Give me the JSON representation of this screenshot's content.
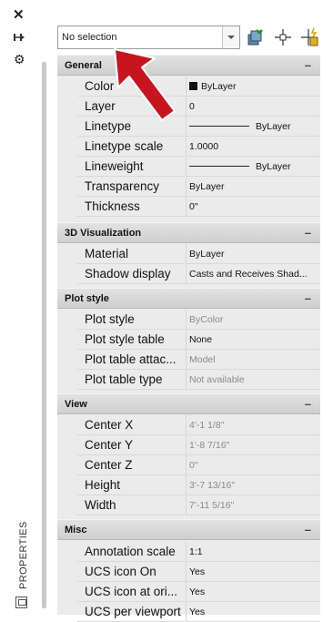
{
  "palette": {
    "selected": "No selection"
  },
  "sections": {
    "general": {
      "title": "General",
      "rows": [
        {
          "name": "Color",
          "value": "ByLayer"
        },
        {
          "name": "Layer",
          "value": "0"
        },
        {
          "name": "Linetype",
          "value": "ByLayer"
        },
        {
          "name": "Linetype scale",
          "value": "1.0000"
        },
        {
          "name": "Lineweight",
          "value": "ByLayer"
        },
        {
          "name": "Transparency",
          "value": "ByLayer"
        },
        {
          "name": "Thickness",
          "value": "0\""
        }
      ]
    },
    "viz3d": {
      "title": "3D Visualization",
      "rows": [
        {
          "name": "Material",
          "value": "ByLayer"
        },
        {
          "name": "Shadow display",
          "value": "Casts and Receives Shad..."
        }
      ]
    },
    "plot": {
      "title": "Plot style",
      "rows": [
        {
          "name": "Plot style",
          "value": "ByColor"
        },
        {
          "name": "Plot style table",
          "value": "None"
        },
        {
          "name": "Plot table attac...",
          "value": "Model"
        },
        {
          "name": "Plot table type",
          "value": "Not available"
        }
      ]
    },
    "view": {
      "title": "View",
      "rows": [
        {
          "name": "Center X",
          "value": "4'-1 1/8\""
        },
        {
          "name": "Center Y",
          "value": "1'-8 7/16\""
        },
        {
          "name": "Center Z",
          "value": "0\""
        },
        {
          "name": "Height",
          "value": "3'-7 13/16\""
        },
        {
          "name": "Width",
          "value": "7'-11 5/16\""
        }
      ]
    },
    "misc": {
      "title": "Misc",
      "rows": [
        {
          "name": "Annotation scale",
          "value": "1:1"
        },
        {
          "name": "UCS icon On",
          "value": "Yes"
        },
        {
          "name": "UCS icon at ori...",
          "value": "Yes"
        },
        {
          "name": "UCS per viewport",
          "value": "Yes"
        }
      ]
    }
  },
  "sidebar": {
    "title": "PROPERTIES"
  },
  "icons": {
    "close": "close-icon",
    "pin": "pin-icon",
    "settings": "gear-icon",
    "dropdown": "chevron-down-icon",
    "quick_select": "quick-select-icon",
    "select_objects": "select-objects-icon",
    "toggle_pickadd": "pickadd-toggle-icon",
    "properties_panel": "properties-panel-icon",
    "pointer": "red-pointer-arrow"
  },
  "colors": {
    "panel_bg": "#ebebeb",
    "section_bg": "#d6d6d6",
    "arrow": "#c8141e",
    "dim_text": "#8a8a8a"
  }
}
